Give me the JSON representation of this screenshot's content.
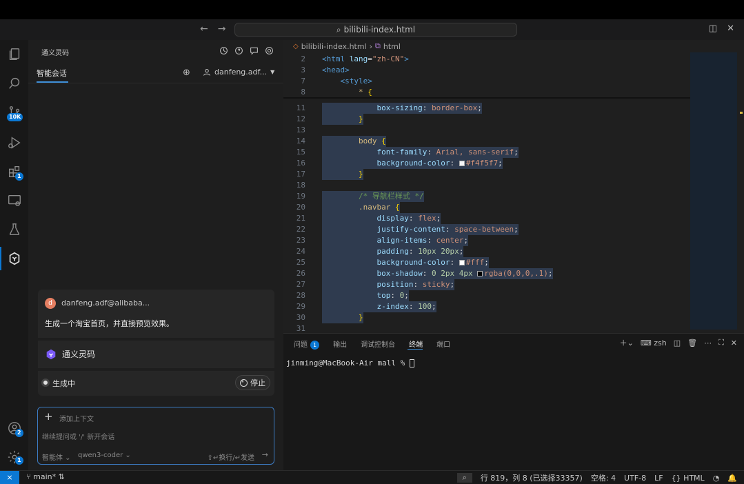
{
  "titlebar": {
    "back": "←",
    "forward": "→",
    "search_text": "bilibili-index.html",
    "layout_icon": "◫",
    "close": "✕"
  },
  "activity": {
    "source_control_badge": "10K",
    "extensions_badge": "1",
    "accounts_badge": "2",
    "settings_badge": "1"
  },
  "sidebar": {
    "title": "通义灵码",
    "tab": "智能会话",
    "add": "⊕",
    "user": "danfeng.adf...",
    "message": {
      "avatar": "d",
      "name": "danfeng.adf@alibaba...",
      "text": "生成一个淘宝首页，并直接预览效果。"
    },
    "bot_name": "通义灵码",
    "generating": "生成中",
    "stop": "停止",
    "input": {
      "plus": "+",
      "context_label": "添加上下文",
      "placeholder": "继续提问或 '/' 新开会话",
      "mode": "智能体 ⌄",
      "model": "qwen3-coder ⌄",
      "send_hint": "⇧↵换行/↵发送",
      "send": "→"
    }
  },
  "editor": {
    "breadcrumb": {
      "file": "bilibili-index.html",
      "sep": "›",
      "node": "html"
    },
    "lines": [
      {
        "n": "2",
        "html": "<span class=\"tag\">&lt;html</span> <span class=\"attr\">lang</span>=<span class=\"str\">\"zh-CN\"</span><span class=\"tag\">&gt;</span>"
      },
      {
        "n": "3",
        "html": "<span class=\"tag\">&lt;head&gt;</span>"
      },
      {
        "n": "7",
        "html": "    <span class=\"tag\">&lt;style&gt;</span>"
      },
      {
        "n": "8",
        "html": "        <span class=\"sel-name\">*</span> <span class=\"brace\">{</span>"
      },
      {
        "n": "11",
        "html": "            <span class=\"prop\">box-sizing</span>: <span class=\"val\">border-box</span>;"
      },
      {
        "n": "12",
        "html": "        <span class=\"brace\">}</span>"
      },
      {
        "n": "13",
        "html": ""
      },
      {
        "n": "14",
        "html": "        <span class=\"sel-name\">body</span> <span class=\"brace\">{</span>"
      },
      {
        "n": "15",
        "html": "            <span class=\"prop\">font-family</span>: <span class=\"val\">Arial, sans-serif</span>;"
      },
      {
        "n": "16",
        "html": "            <span class=\"prop\">background-color</span>: <span class=\"swatch\" style=\"background:#f4f5f7\"></span><span class=\"val\">#f4f5f7</span>;"
      },
      {
        "n": "17",
        "html": "        <span class=\"brace\">}</span>"
      },
      {
        "n": "18",
        "html": ""
      },
      {
        "n": "19",
        "html": "        <span class=\"cmt\">/* 导航栏样式 */</span>"
      },
      {
        "n": "20",
        "html": "        <span class=\"sel-name\">.navbar</span> <span class=\"brace\">{</span>"
      },
      {
        "n": "21",
        "html": "            <span class=\"prop\">display</span>: <span class=\"val\">flex</span>;"
      },
      {
        "n": "22",
        "html": "            <span class=\"prop\">justify-content</span>: <span class=\"val\">space-between</span>;"
      },
      {
        "n": "23",
        "html": "            <span class=\"prop\">align-items</span>: <span class=\"val\">center</span>;"
      },
      {
        "n": "24",
        "html": "            <span class=\"prop\">padding</span>: <span class=\"num\">10px 20px</span>;"
      },
      {
        "n": "25",
        "html": "            <span class=\"prop\">background-color</span>: <span class=\"swatch\" style=\"background:#fff\"></span><span class=\"val\">#fff</span>;"
      },
      {
        "n": "26",
        "html": "            <span class=\"prop\">box-shadow</span>: <span class=\"num\">0 2px 4px</span> <span class=\"swatch\" style=\"background:#000\"></span><span class=\"val\">rgba(0,0,0,.1)</span>;"
      },
      {
        "n": "27",
        "html": "            <span class=\"prop\">position</span>: <span class=\"val\">sticky</span>;"
      },
      {
        "n": "28",
        "html": "            <span class=\"prop\">top</span>: <span class=\"num\">0</span>;"
      },
      {
        "n": "29",
        "html": "            <span class=\"prop\">z-index</span>: <span class=\"num\">100</span>;"
      },
      {
        "n": "30",
        "html": "        <span class=\"brace\">}</span>"
      },
      {
        "n": "31",
        "html": ""
      }
    ]
  },
  "panel": {
    "tabs": [
      "问题",
      "输出",
      "调试控制台",
      "终端",
      "端口"
    ],
    "problems_badge": "1",
    "active_tab": "终端",
    "shell": "zsh",
    "terminal_prompt": "jinming@MacBook-Air mall % "
  },
  "statusbar": {
    "remote": "⨯",
    "branch": "main*",
    "cursor": "行 819，列 8 (已选择33357)",
    "spaces": "空格: 4",
    "encoding": "UTF-8",
    "eol": "LF",
    "language": "HTML"
  }
}
